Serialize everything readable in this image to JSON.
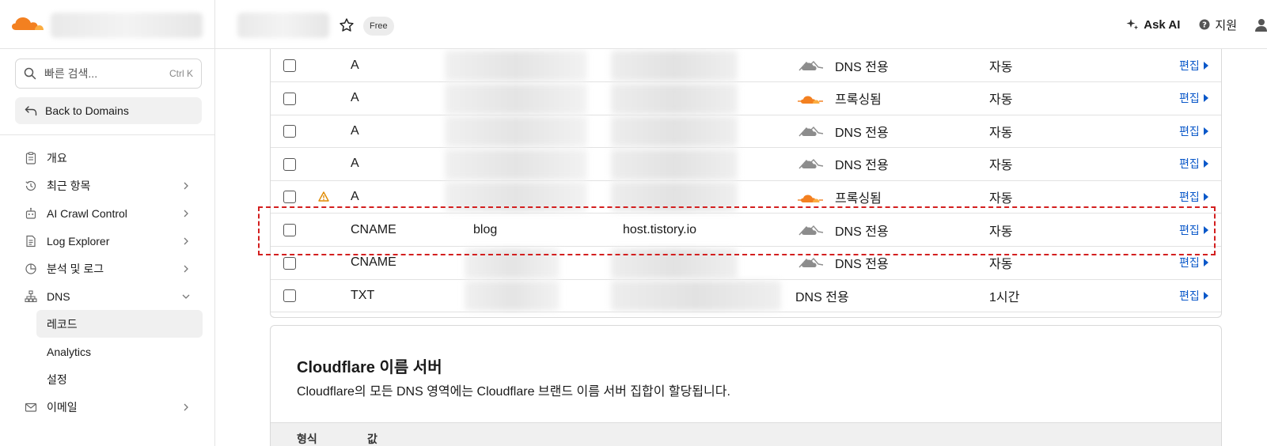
{
  "colors": {
    "brand_orange": "#f38020",
    "link_blue": "#0a58c9",
    "highlight_red": "#d31f1f",
    "cloud_gray": "#8c8c8c"
  },
  "header": {
    "logo_icon": "cloudflare-logo",
    "star_icon": "star-icon",
    "plan_badge": "Free",
    "ask_ai_label": "Ask AI",
    "ask_ai_icon": "sparkle-icon",
    "support_label": "지원",
    "support_icon": "help-circle-icon",
    "user_icon": "user-icon"
  },
  "sidebar": {
    "search_placeholder": "빠른 검색...",
    "search_shortcut": "Ctrl K",
    "back_label": "Back to Domains",
    "items": [
      {
        "label": "개요",
        "icon": "clipboard-icon"
      },
      {
        "label": "최근 항목",
        "icon": "history-icon"
      },
      {
        "label": "AI Crawl Control",
        "icon": "robot-icon"
      },
      {
        "label": "Log Explorer",
        "icon": "document-icon"
      },
      {
        "label": "분석 및 로그",
        "icon": "chart-pie-icon"
      },
      {
        "label": "DNS",
        "icon": "network-icon"
      }
    ],
    "dns_sub": [
      {
        "label": "레코드",
        "active": true
      },
      {
        "label": "Analytics",
        "active": false
      },
      {
        "label": "설정",
        "active": false
      }
    ],
    "after_items": [
      {
        "label": "이메일",
        "icon": "email-icon"
      }
    ]
  },
  "records": {
    "edit_label": "편집",
    "rows": [
      {
        "type": "A",
        "name": "",
        "content": "",
        "proxy": "DNS 전용",
        "proxied": false,
        "ttl": "자동",
        "warning": false
      },
      {
        "type": "A",
        "name": "",
        "content": "",
        "proxy": "프록싱됨",
        "proxied": true,
        "ttl": "자동",
        "warning": false
      },
      {
        "type": "A",
        "name": "",
        "content": "",
        "proxy": "DNS 전용",
        "proxied": false,
        "ttl": "자동",
        "warning": false
      },
      {
        "type": "A",
        "name": "",
        "content": "",
        "proxy": "DNS 전용",
        "proxied": false,
        "ttl": "자동",
        "warning": false
      },
      {
        "type": "A",
        "name": "",
        "content": "",
        "proxy": "프록싱됨",
        "proxied": true,
        "ttl": "자동",
        "warning": true
      },
      {
        "type": "CNAME",
        "name": "blog",
        "content": "host.tistory.io",
        "proxy": "DNS 전용",
        "proxied": false,
        "ttl": "자동",
        "warning": false
      },
      {
        "type": "CNAME",
        "name": "",
        "content": "",
        "proxy": "DNS 전용",
        "proxied": false,
        "ttl": "자동",
        "warning": false
      },
      {
        "type": "TXT",
        "name": "",
        "content": "",
        "proxy": "DNS 전용",
        "proxied": null,
        "ttl": "1시간",
        "warning": false
      }
    ]
  },
  "nameservers": {
    "title": "Cloudflare 이름 서버",
    "description": "Cloudflare의 모든 DNS 영역에는 Cloudflare 브랜드 이름 서버 집합이 할당됩니다.",
    "col_type": "형식",
    "col_value": "값"
  }
}
